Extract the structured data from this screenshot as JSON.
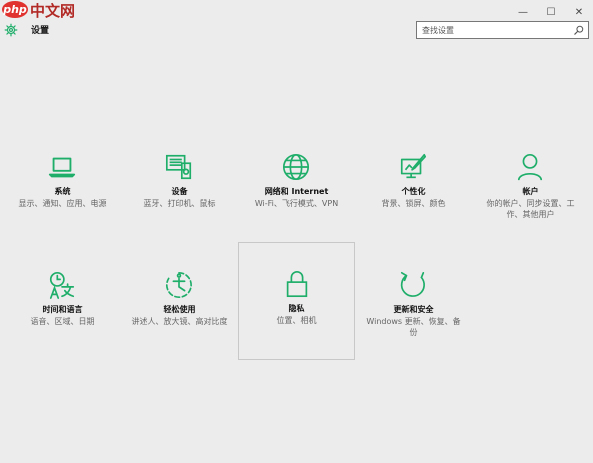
{
  "watermark": {
    "badge": "php",
    "text": "中文网"
  },
  "window_controls": {
    "minimize": "—",
    "maximize": "☐",
    "close": "✕"
  },
  "app": {
    "title": "设置"
  },
  "search": {
    "placeholder": "查找设置"
  },
  "colors": {
    "accent": "#1fae6a",
    "background": "#ececec"
  },
  "tiles": [
    {
      "icon": "laptop-icon",
      "label": "系统",
      "desc": "显示、通知、应用、电源"
    },
    {
      "icon": "devices-icon",
      "label": "设备",
      "desc": "蓝牙、打印机、鼠标"
    },
    {
      "icon": "globe-icon",
      "label": "网络和 Internet",
      "desc": "Wi-Fi、飞行模式、VPN"
    },
    {
      "icon": "personalization-icon",
      "label": "个性化",
      "desc": "背景、锁屏、颜色"
    },
    {
      "icon": "person-icon",
      "label": "帐户",
      "desc": "你的帐户、同步设置、工作、其他用户"
    },
    {
      "icon": "time-language-icon",
      "label": "时间和语言",
      "desc": "语音、区域、日期"
    },
    {
      "icon": "ease-of-access-icon",
      "label": "轻松使用",
      "desc": "讲述人、放大镜、高对比度"
    },
    {
      "icon": "lock-icon",
      "label": "隐私",
      "desc": "位置、相机"
    },
    {
      "icon": "update-icon",
      "label": "更新和安全",
      "desc": "Windows 更新、恢复、备份"
    }
  ]
}
